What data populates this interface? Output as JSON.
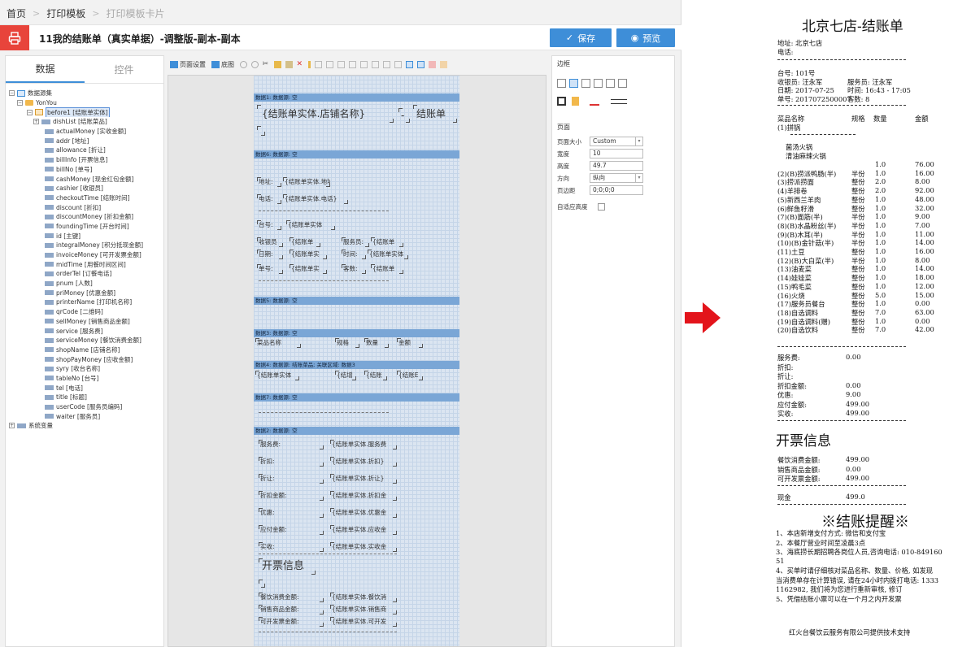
{
  "breadcrumb": [
    "首页",
    "打印模板",
    "打印模板卡片"
  ],
  "title": "11我的结账单（真实单据）-调整版-副本-副本",
  "buttons": {
    "save": "保存",
    "preview": "预览"
  },
  "left_tabs": [
    "数据",
    "控件"
  ],
  "tree": {
    "root": "数据源集",
    "company": "YonYou",
    "entity": "before1 [结账单实体]",
    "child_table": "dishList [结账菜品]",
    "fields": [
      "actualMoney [实收金额]",
      "addr [地址]",
      "allowance [折让]",
      "billInfo [开票信息]",
      "billNo [单号]",
      "cashMoney [现金红包金额]",
      "cashier [收银员]",
      "checkoutTime [结账时间]",
      "discount [折扣]",
      "discountMoney [折扣金额]",
      "foundingTime [开台时间]",
      "id [主键]",
      "integralMoney [积分抵现金额]",
      "invoiceMoney [可开发票金额]",
      "midTime [用餐时间区间]",
      "orderTel [订餐电话]",
      "pnum [人数]",
      "priMoney [优惠金额]",
      "printerName [打印机名称]",
      "qrCode [二维码]",
      "sellMoney [销售商品金额]",
      "service [服务费]",
      "serviceMoney [餐饮消费金额]",
      "shopName [店铺名称]",
      "shopPayMoney [应收金额]",
      "syry [收台名称]",
      "tableNo [台号]",
      "tel [电话]",
      "title [标题]",
      "userCode [服务员编码]",
      "waiter [服务员]"
    ],
    "system": "系统变量"
  },
  "toolbar": {
    "page_setup": "页面设置",
    "base_map": "底图"
  },
  "designer": {
    "bands": [
      "数据1: 数据源: 空",
      "数据6: 数据源: 空",
      "数据5: 数据源: 空",
      "数据3: 数据源: 空",
      "数据4: 数据源: 结账菜品; 关联区域: 数据3",
      "数据7: 数据源: 空",
      "数据2: 数据源: 空"
    ],
    "cells": {
      "shop_name": "{结账单实体.店铺名称}",
      "dash": "-",
      "bill_word": "结账单",
      "addr_label": "地址:",
      "addr_val": "{结账单实体.地址}",
      "tel_label": "电话:",
      "tel_val": "{结账单实体.电话}",
      "table_label": "台号:",
      "table_val": "{结账单实体",
      "cashier_label": "收银员",
      "cashier_val": "{结账单",
      "waiter_label": "服务员:",
      "waiter_val": "{结账单",
      "date_label": "日期:",
      "date_val": "{结账单实",
      "time_label": "时间:",
      "time_val": "{结账单实体",
      "no_label": "单号:",
      "no_val": "{结账单实",
      "guests_label": "客数:",
      "guests_val": "{结账单",
      "h_name": "菜品名称",
      "h_spec": "规格",
      "h_qty": "数量",
      "h_amt": "金额",
      "d_name": "{结账单实体",
      "d_spec": "{结增",
      "d_qty": "{结账",
      "d_amt": "{结账E",
      "s_service": "服务费:",
      "v_service": "{结账单实体.服务费",
      "s_discount": "折扣:",
      "v_discount": "{结账单实体.折扣}",
      "s_allow": "折让:",
      "v_allow": "{结账单实体.折让}",
      "s_dmoney": "折扣金额:",
      "v_dmoney": "{结账单实体.折扣金",
      "s_pri": "优惠:",
      "v_pri": "{结账单实体.优惠金",
      "s_pay": "应付金额:",
      "v_pay": "{结账单实体.应收金",
      "s_actual": "实收:",
      "v_actual": "{结账单实体.实收金",
      "invoice_title": "开票信息",
      "s_meal": "餐饮消费金额:",
      "v_meal": "{结账单实体.餐饮消",
      "s_sell": "销售商品金额:",
      "v_sell": "{结账单实体.销售商",
      "s_inv": "可开发票金额:",
      "v_inv": "{结账单实体.可开发"
    }
  },
  "props": {
    "border_title": "边框",
    "page_title": "页面",
    "rows": [
      {
        "label": "页面大小",
        "value": "Custom",
        "dropdown": true
      },
      {
        "label": "宽度",
        "value": "10",
        "dropdown": false
      },
      {
        "label": "高度",
        "value": "49.7",
        "dropdown": false
      },
      {
        "label": "方向",
        "value": "纵向",
        "dropdown": true
      },
      {
        "label": "页边距",
        "value": "0;0;0;0",
        "dropdown": false
      }
    ],
    "auto_height": "自适应高度"
  },
  "receipt": {
    "title": "北京七店-结账单",
    "addr": "地址: 北京七店",
    "tel": "电话:",
    "table": "台号:    101号",
    "cashier": "收银员: 汪永军",
    "waiter": "服务员: 汪永军",
    "date": "日期:    2017-07-25",
    "time": "时间:    16:43 - 17:05",
    "billno": "单号:    2017072500007",
    "guests": "客数:      8",
    "col_name": "菜品名称",
    "col_spec": "规格",
    "col_qty": "数量",
    "col_amt": "金额",
    "pot": "(1)拼锅",
    "sub1": "菌汤火锅",
    "sub2": "清油麻辣火锅",
    "items": [
      {
        "name": "",
        "spec": "",
        "qty": "1.0",
        "amt": "76.00"
      },
      {
        "name": "(2)(B)捞派鸭肠(半)",
        "spec": "半份",
        "qty": "1.0",
        "amt": "16.00"
      },
      {
        "name": "(3)捞派捞面",
        "spec": "整份",
        "qty": "2.0",
        "amt": "8.00"
      },
      {
        "name": "(4)羊排卷",
        "spec": "整份",
        "qty": "2.0",
        "amt": "92.00"
      },
      {
        "name": "(5)新西兰羊肉",
        "spec": "整份",
        "qty": "1.0",
        "amt": "48.00"
      },
      {
        "name": "(6)鲜鱼籽滑",
        "spec": "整份",
        "qty": "1.0",
        "amt": "32.00"
      },
      {
        "name": "(7)(B)面筋(半)",
        "spec": "半份",
        "qty": "1.0",
        "amt": "9.00"
      },
      {
        "name": "(8)(B)水晶粉丝(半)",
        "spec": "半份",
        "qty": "1.0",
        "amt": "7.00"
      },
      {
        "name": "(9)(B)木耳(半)",
        "spec": "半份",
        "qty": "1.0",
        "amt": "11.00"
      },
      {
        "name": "(10)(B)金针菇(半)",
        "spec": "半份",
        "qty": "1.0",
        "amt": "14.00"
      },
      {
        "name": "(11)土豆",
        "spec": "整份",
        "qty": "1.0",
        "amt": "16.00"
      },
      {
        "name": "(12)(B)大白菜(半)",
        "spec": "半份",
        "qty": "1.0",
        "amt": "8.00"
      },
      {
        "name": "(13)油麦菜",
        "spec": "整份",
        "qty": "1.0",
        "amt": "14.00"
      },
      {
        "name": "(14)娃娃菜",
        "spec": "整份",
        "qty": "1.0",
        "amt": "18.00"
      },
      {
        "name": "(15)鸭毛菜",
        "spec": "整份",
        "qty": "1.0",
        "amt": "12.00"
      },
      {
        "name": "(16)火烧",
        "spec": "整份",
        "qty": "5.0",
        "amt": "15.00"
      },
      {
        "name": "(17)服务员餐台",
        "spec": "整份",
        "qty": "1.0",
        "amt": "0.00"
      },
      {
        "name": "(18)自选调料",
        "spec": "整份",
        "qty": "7.0",
        "amt": "63.00"
      },
      {
        "name": "(19)自选调料(赠)",
        "spec": "整份",
        "qty": "1.0",
        "amt": "0.00"
      },
      {
        "name": "(20)自选饮料",
        "spec": "整份",
        "qty": "7.0",
        "amt": "42.00"
      }
    ],
    "summary": [
      {
        "label": "服务费:",
        "value": "0.00"
      },
      {
        "label": "折扣:",
        "value": ""
      },
      {
        "label": "折让:",
        "value": ""
      },
      {
        "label": "折扣金额:",
        "value": "0.00"
      },
      {
        "label": "优惠:",
        "value": "9.00"
      },
      {
        "label": "应付金额:",
        "value": "499.00"
      },
      {
        "label": "实收:",
        "value": "499.00"
      }
    ],
    "invoice_title": "开票信息",
    "invoice": [
      {
        "label": "餐饮消费金额:",
        "value": "499.00"
      },
      {
        "label": "销售商品金额:",
        "value": "0.00"
      },
      {
        "label": "可开发票金额:",
        "value": "499.00"
      }
    ],
    "cash_label": "现金",
    "cash_value": "499.0",
    "reminder_title": "※结账提醒※",
    "reminder_lines": [
      "1、本店新增支付方式: 微信和支付宝",
      "2、本餐厅营业时间至凌晨3点",
      "3、海底捞长期招聘各岗位人员,咨询电话: 010-849160",
      "51",
      "4、买单时请仔细核对菜品名称、数量、价格, 如发现",
      "当消费单存在计算错误, 请在24小时内拨打电话: 1333",
      "1162982, 我们将为您进行重新审核, 修订",
      "5、凭借结账小票可以在一个月之内开发票"
    ],
    "footer": "红火台餐饮云服务有限公司提供技术支持"
  },
  "colors": {
    "accent": "#3e8ed8",
    "title_icon": "#e8443b",
    "arrow": "#e3141b",
    "band": "#7aa6d6"
  }
}
